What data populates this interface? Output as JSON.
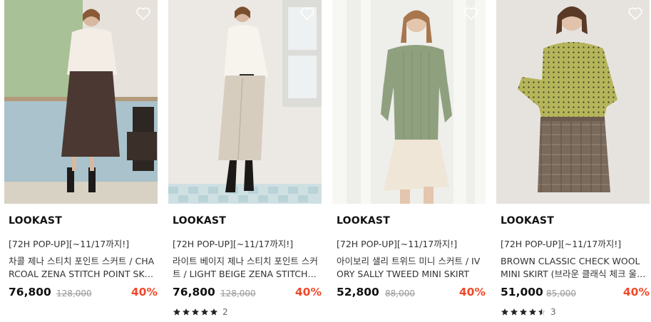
{
  "products": [
    {
      "brand": "LOOKAST",
      "promo": "[72H POP-UP][~11/17까지!]",
      "name": "차콜 제나 스티치 포인트 스커트 / CHARCOAL ZENA STITCH POINT SKIRT",
      "price": "76,800",
      "original_price": "128,000",
      "discount": "40%",
      "rating_stars": null,
      "review_count": null,
      "image_colors": {
        "bg": "#a9c2cc",
        "top": "#f3ede6",
        "bottom": "#4b3832"
      }
    },
    {
      "brand": "LOOKAST",
      "promo": "[72H POP-UP][~11/17까지!]",
      "name": "라이트 베이지 제나 스티치 포인트 스커트 / LIGHT BEIGE ZENA STITCH POINT SKIRT",
      "price": "76,800",
      "original_price": "128,000",
      "discount": "40%",
      "rating_stars": 5,
      "review_count": "2",
      "image_colors": {
        "bg": "#ece9e4",
        "top": "#f7f4ee",
        "bottom": "#d7cdbf"
      }
    },
    {
      "brand": "LOOKAST",
      "promo": "[72H POP-UP][~11/17까지!]",
      "name": "아이보리 샐리 트위드 미니 스커트 / IVORY SALLY TWEED MINI SKIRT",
      "price": "52,800",
      "original_price": "88,000",
      "discount": "40%",
      "rating_stars": null,
      "review_count": null,
      "image_colors": {
        "bg": "#eeeeea",
        "top": "#8fa07f",
        "bottom": "#efe6d7"
      }
    },
    {
      "brand": "LOOKAST",
      "promo": "[72H POP-UP][~11/17까지!]",
      "name": "BROWN CLASSIC CHECK WOOL MINI SKIRT (브라운 클래식 체크 울 미니 스커트)",
      "price": "51,000",
      "original_price": "85,000",
      "discount": "40%",
      "rating_stars": 4.5,
      "review_count": "3",
      "image_colors": {
        "bg": "#e6e3df",
        "top": "#b5b55a",
        "bottom": "#7a6a5b"
      }
    }
  ],
  "colors": {
    "discount": "#f04a2a",
    "star": "#222222",
    "wishlist": "#ffffff"
  },
  "icons": {
    "wishlist": "heart-outline-icon",
    "star": "star-icon"
  }
}
